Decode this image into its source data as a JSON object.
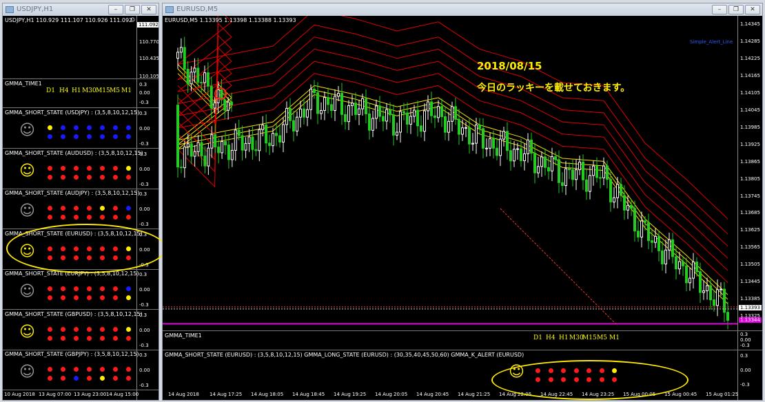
{
  "left_window": {
    "title": "USDJPY,H1",
    "chart_header": "USDJPY,H1  110.929 111.107 110.926 111.092",
    "price_tag": "111.092",
    "price_labels": [
      "110.770",
      "110.435",
      "110.105"
    ],
    "x_labels": [
      "10 Aug 2018",
      "13 Aug 07:00",
      "13 Aug 23:00",
      "14 Aug 15:00"
    ],
    "time_pane": {
      "title": "GMMA_TIME1",
      "axis": [
        "0.3",
        "0.00",
        "-0.3"
      ]
    },
    "panels": [
      {
        "title": "GMMA_SHORT_STATE (USDJPY) : (3,5,8,10,12,15)",
        "smiley": "gray",
        "row1": [
          "yellow",
          "blue",
          "blue",
          "blue",
          "blue",
          "blue",
          "blue"
        ],
        "row2": [
          "blue",
          "blue",
          "blue",
          "blue",
          "blue",
          "blue",
          "blue"
        ]
      },
      {
        "title": "GMMA_SHORT_STATE (AUDUSD) : (3,5,8,10,12,15)",
        "smiley": "yellow",
        "row1": [
          "red",
          "red",
          "red",
          "red",
          "red",
          "red",
          "yellow"
        ],
        "row2": [
          "red",
          "red",
          "red",
          "red",
          "red",
          "red",
          "red"
        ]
      },
      {
        "title": "GMMA_SHORT_STATE (AUDJPY) : (3,5,8,10,12,15)",
        "smiley": "gray",
        "row1": [
          "red",
          "red",
          "red",
          "red",
          "yellow",
          "red",
          "blue"
        ],
        "row2": [
          "red",
          "red",
          "red",
          "red",
          "red",
          "red",
          "red"
        ]
      },
      {
        "title": "GMMA_SHORT_STATE (EURUSD) : (3,5,8,10,12,15)",
        "smiley": "yellow",
        "row1": [
          "red",
          "red",
          "red",
          "red",
          "red",
          "red",
          "yellow"
        ],
        "row2": [
          "red",
          "red",
          "red",
          "red",
          "red",
          "red",
          "red"
        ]
      },
      {
        "title": "GMMA_SHORT_STATE (EURJPY) : (3,5,8,10,12,15)",
        "smiley": "gray",
        "row1": [
          "red",
          "red",
          "red",
          "red",
          "red",
          "red",
          "blue"
        ],
        "row2": [
          "red",
          "red",
          "red",
          "red",
          "red",
          "red",
          "yellow"
        ]
      },
      {
        "title": "GMMA_SHORT_STATE (GBPUSD) : (3,5,8,10,12,15)",
        "smiley": "yellow",
        "row1": [
          "red",
          "red",
          "red",
          "red",
          "red",
          "red",
          "yellow"
        ],
        "row2": [
          "red",
          "red",
          "red",
          "red",
          "red",
          "red",
          "red"
        ]
      },
      {
        "title": "GMMA_SHORT_STATE (GBPJPY) : (3,5,8,10,12,15)",
        "smiley": "gray",
        "row1": [
          "red",
          "red",
          "red",
          "red",
          "red",
          "red",
          "red"
        ],
        "row2": [
          "red",
          "red",
          "blue",
          "red",
          "yellow",
          "red",
          "red"
        ]
      }
    ],
    "panel_axis": [
      "0.3",
      "0.00",
      "-0.3"
    ]
  },
  "right_window": {
    "title": "EURUSD,M5",
    "chart_header": "EURUSD,M5  1.13395 1.13398 1.13388 1.13393",
    "alert_link": "Simple_Alert_Line",
    "annotation_date": "2018/08/15",
    "annotation_text": "今日のラッキーを載せておきます。",
    "price_labels": [
      "1.14345",
      "1.14285",
      "1.14225",
      "1.14165",
      "1.14105",
      "1.14045",
      "1.13985",
      "1.13925",
      "1.13865",
      "1.13805",
      "1.13745",
      "1.13685",
      "1.13625",
      "1.13565",
      "1.13505",
      "1.13445",
      "1.13385",
      "1.13325"
    ],
    "current_price": "1.13393",
    "line_price": "1.13344",
    "x_labels": [
      "14 Aug 2018",
      "14 Aug 17:25",
      "14 Aug 18:05",
      "14 Aug 18:45",
      "14 Aug 19:25",
      "14 Aug 20:05",
      "14 Aug 20:45",
      "14 Aug 21:25",
      "14 Aug 22:05",
      "14 Aug 22:45",
      "14 Aug 23:25",
      "15 Aug 00:05",
      "15 Aug 00:45",
      "15 Aug 01:25"
    ],
    "time_pane": {
      "title": "GMMA_TIME1",
      "axis": [
        "0.3",
        "0.00",
        "-0.3"
      ]
    },
    "state_pane": {
      "title": "GMMA_SHORT_STATE (EURUSD) : (3,5,8,10,12,15)  GMMA_LONG_STATE (EURUSD) : (30,35,40,45,50,60)  GMMA_K_ALERT (EURUSD)",
      "axis": [
        "0.3",
        "0.00",
        "-0.3"
      ],
      "smiley": "yellow",
      "row1": [
        "red",
        "red",
        "red",
        "red",
        "red",
        "red",
        "yellow"
      ],
      "row2": [
        "red",
        "red",
        "red",
        "red",
        "red",
        "red",
        "red"
      ]
    }
  },
  "timeframes": [
    "D1",
    "H4",
    "H1",
    "M30",
    "M15",
    "M5",
    "M1"
  ],
  "button_labels": {
    "minimize": "–",
    "restore": "❐",
    "close": "✕"
  },
  "colors": {
    "red": "#ff1a1a",
    "yellow": "#ffee00",
    "blue": "#1a1aff",
    "gray": "#9a9a9a",
    "highlight": "#ffea00",
    "magenta": "#e000e0"
  },
  "chart_data": {
    "type": "candlestick",
    "symbol": "EURUSD",
    "timeframe": "M5",
    "ylim": [
      1.1332,
      1.1436
    ],
    "close_path_approx": [
      {
        "t": "14 Aug 17:05",
        "p": 1.1422
      },
      {
        "t": "14 Aug 17:25",
        "p": 1.1404
      },
      {
        "t": "14 Aug 17:45",
        "p": 1.139
      },
      {
        "t": "14 Aug 18:05",
        "p": 1.1396
      },
      {
        "t": "14 Aug 18:45",
        "p": 1.1408
      },
      {
        "t": "14 Aug 19:25",
        "p": 1.1405
      },
      {
        "t": "14 Aug 20:05",
        "p": 1.1401
      },
      {
        "t": "14 Aug 20:45",
        "p": 1.1404
      },
      {
        "t": "14 Aug 21:25",
        "p": 1.1395
      },
      {
        "t": "14 Aug 22:05",
        "p": 1.1391
      },
      {
        "t": "14 Aug 22:45",
        "p": 1.1384
      },
      {
        "t": "14 Aug 23:25",
        "p": 1.1383
      },
      {
        "t": "15 Aug 00:05",
        "p": 1.1364
      },
      {
        "t": "15 Aug 00:45",
        "p": 1.1352
      },
      {
        "t": "15 Aug 01:25",
        "p": 1.1339
      }
    ],
    "last_price": 1.13393,
    "horizontal_line": 1.13344
  }
}
